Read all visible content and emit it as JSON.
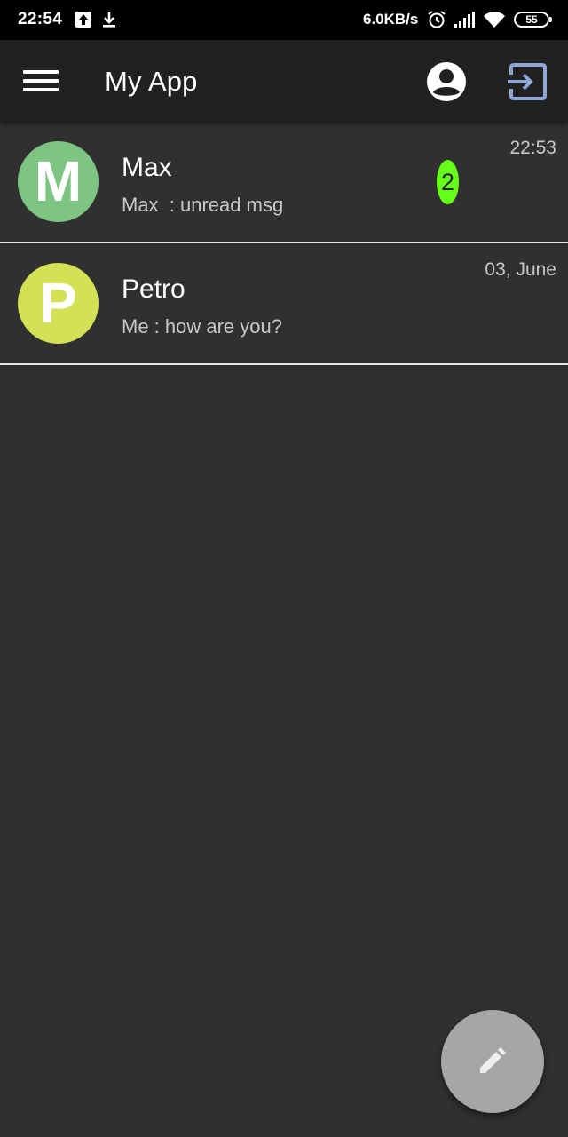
{
  "status_bar": {
    "time": "22:54",
    "network_speed": "6.0KB/s",
    "battery_level": "55",
    "icons": [
      "upload-icon",
      "download-icon",
      "alarm-icon",
      "signal-icon",
      "wifi-icon",
      "battery-icon"
    ]
  },
  "app_bar": {
    "title": "My App",
    "icons": [
      "menu-icon",
      "account-circle-icon",
      "logout-icon"
    ],
    "logout_icon_color": "#8ea6d6"
  },
  "chats": [
    {
      "initial": "M",
      "name": "Max",
      "preview": "Max  : unread msg",
      "time": "22:53",
      "unread_count": "2",
      "avatar_color": "#7ec483"
    },
    {
      "initial": "P",
      "name": "Petro",
      "preview": "Me : how are you?",
      "time": "03, June",
      "avatar_color": "#d4e157"
    }
  ],
  "fab": {
    "icon": "edit-icon"
  },
  "colors": {
    "background": "#303030",
    "app_bar": "#212121",
    "badge": "#66ff1a",
    "divider": "#e6e6e6",
    "fab": "#a6a6a6"
  }
}
